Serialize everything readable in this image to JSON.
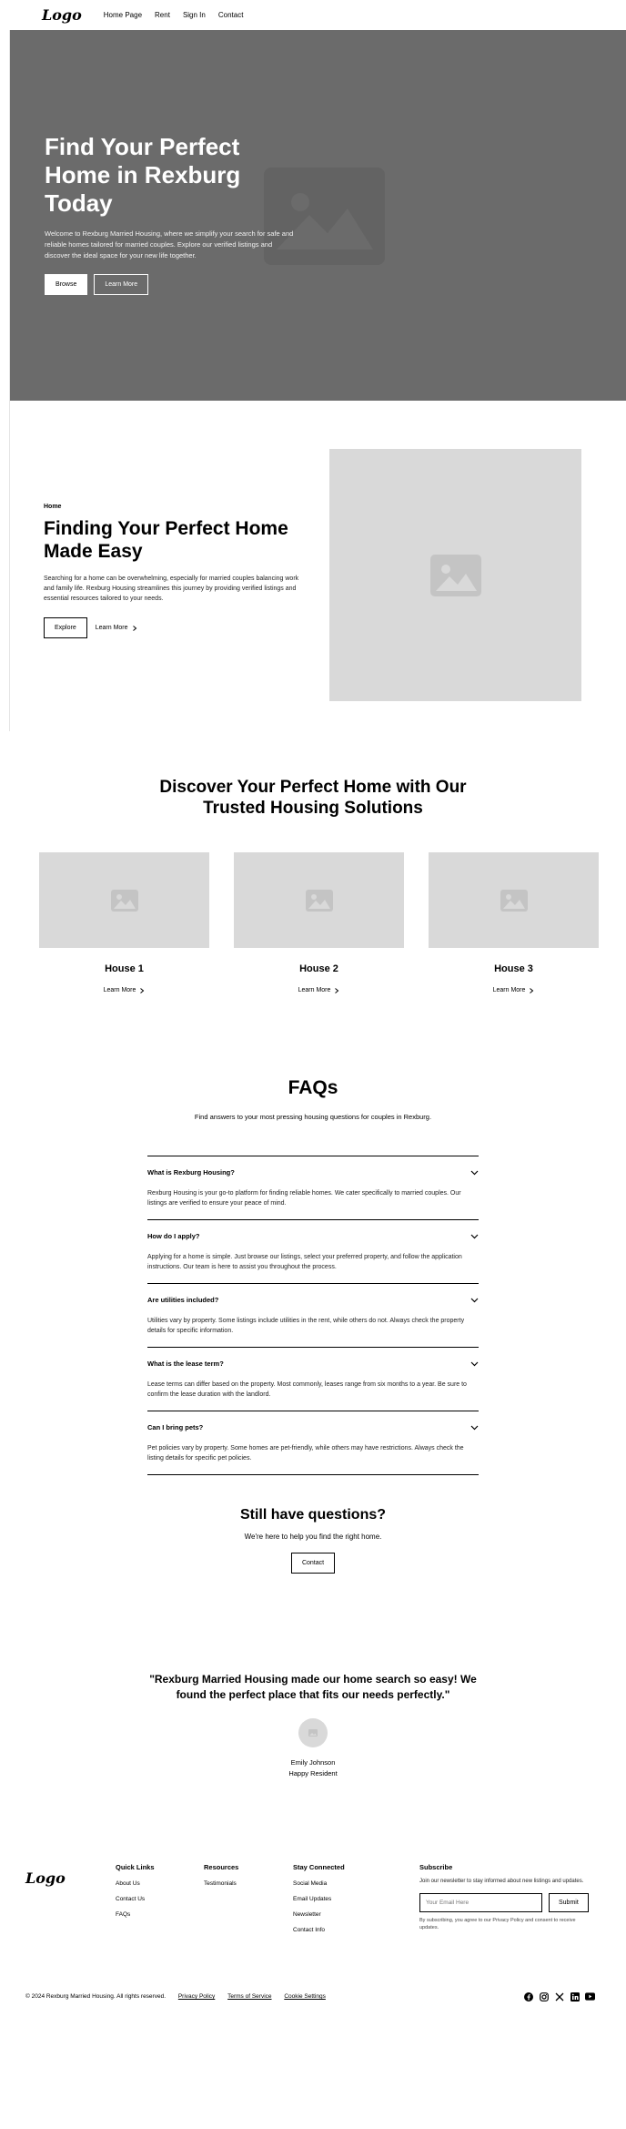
{
  "nav": {
    "logo": "Logo",
    "items": [
      "Home Page",
      "Rent",
      "Sign In",
      "Contact"
    ]
  },
  "hero": {
    "title": "Find Your Perfect Home in Rexburg Today",
    "description": "Welcome to Rexburg Married Housing, where we simplify your search for safe and reliable homes tailored for married couples. Explore our verified listings and discover the ideal space for your new life together.",
    "primary_button": "Browse",
    "secondary_button": "Learn More"
  },
  "feature": {
    "tag": "Home",
    "title": "Finding Your Perfect Home Made Easy",
    "description": "Searching for a home can be overwhelming, especially for married couples balancing work and family life. Rexburg Housing streamlines this journey by providing verified listings and essential resources tailored to your needs.",
    "primary_button": "Explore",
    "link": "Learn More"
  },
  "discover": {
    "title": "Discover Your Perfect Home with Our Trusted Housing Solutions",
    "cards": [
      {
        "title": "House 1",
        "link": "Learn More"
      },
      {
        "title": "House 2",
        "link": "Learn More"
      },
      {
        "title": "House 3",
        "link": "Learn More"
      }
    ]
  },
  "faq": {
    "title": "FAQs",
    "subtitle": "Find answers to your most pressing housing questions for couples in Rexburg.",
    "items": [
      {
        "q": "What is Rexburg Housing?",
        "a": "Rexburg Housing is your go-to platform for finding reliable homes. We cater specifically to married couples. Our listings are verified to ensure your peace of mind."
      },
      {
        "q": "How do I apply?",
        "a": "Applying for a home is simple. Just browse our listings, select your preferred property, and follow the application instructions. Our team is here to assist you throughout the process."
      },
      {
        "q": "Are utilities included?",
        "a": "Utilities vary by property. Some listings include utilities in the rent, while others do not. Always check the property details for specific information."
      },
      {
        "q": "What is the lease term?",
        "a": "Lease terms can differ based on the property. Most commonly, leases range from six months to a year. Be sure to confirm the lease duration with the landlord."
      },
      {
        "q": "Can I bring pets?",
        "a": "Pet policies vary by property. Some homes are pet-friendly, while others may have restrictions. Always check the listing details for specific pet policies."
      }
    ]
  },
  "still": {
    "title": "Still have questions?",
    "subtitle": "We're here to help you find the right home.",
    "button": "Contact"
  },
  "testimonial": {
    "quote": "\"Rexburg Married Housing made our home search so easy! We found the perfect place that fits our needs perfectly.\"",
    "name": "Emily Johnson",
    "role": "Happy Resident"
  },
  "footer": {
    "logo": "Logo",
    "columns": [
      {
        "title": "Quick Links",
        "links": [
          "About Us",
          "Contact Us",
          "FAQs"
        ]
      },
      {
        "title": "Resources",
        "links": [
          "Testimonials"
        ]
      },
      {
        "title": "Stay Connected",
        "links": [
          "Social Media",
          "Email Updates",
          "Newsletter",
          "Contact Info"
        ]
      }
    ],
    "subscribe": {
      "title": "Subscribe",
      "description": "Join our newsletter to stay informed about new listings and updates.",
      "placeholder": "Your Email Here",
      "button": "Submit",
      "fine_print": "By subscribing, you agree to our Privacy Policy and consent to receive updates."
    },
    "copyright": "© 2024 Rexburg Married Housing. All rights reserved.",
    "legal": [
      "Privacy Policy",
      "Terms of Service",
      "Cookie Settings"
    ],
    "social_icons": [
      "facebook-icon",
      "instagram-icon",
      "x-icon",
      "linkedin-icon",
      "youtube-icon"
    ]
  }
}
